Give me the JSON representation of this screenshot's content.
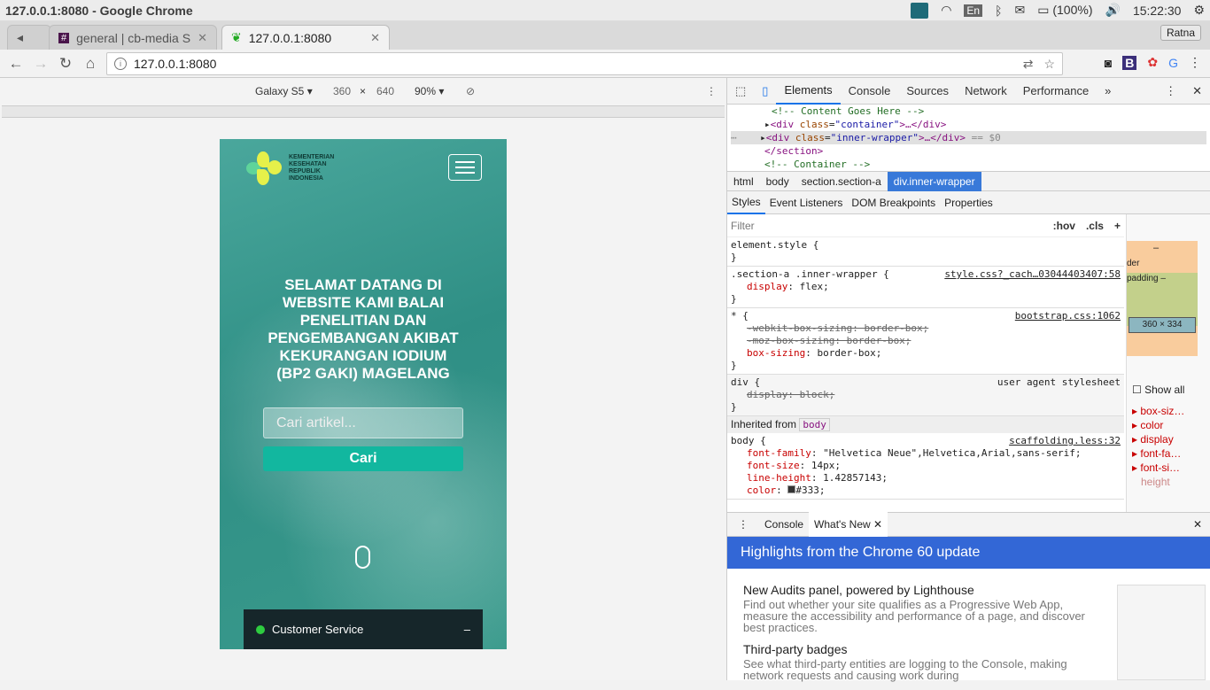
{
  "window": {
    "title": "127.0.0.1:8080 - Google Chrome"
  },
  "tray": {
    "lang": "En",
    "battery": "(100%)",
    "time": "15:22:30"
  },
  "tabs": [
    {
      "label": "general | cb-media S"
    },
    {
      "label": "127.0.0.1:8080"
    }
  ],
  "profile": "Ratna",
  "omnibox": {
    "url": "127.0.0.1:8080"
  },
  "device_toolbar": {
    "device": "Galaxy S5",
    "width": "360",
    "times": "×",
    "height": "640",
    "zoom": "90%"
  },
  "site": {
    "logo_text": "KEMENTERIAN KESEHATAN REPUBLIK INDONESIA",
    "headline": "SELAMAT DATANG DI WEBSITE KAMI BALAI PENELITIAN DAN PENGEMBANGAN AKIBAT KEKURANGAN IODIUM (BP2 GAKI) MAGELANG",
    "search_placeholder": "Cari artikel...",
    "search_button": "Cari",
    "cs_label": "Customer Service",
    "cs_minimize": "–"
  },
  "devtools": {
    "tabs": [
      "Elements",
      "Console",
      "Sources",
      "Network",
      "Performance"
    ],
    "dom": {
      "l1": "<!-- Content Goes Here -->",
      "l2_tag": "div",
      "l2_attr": "class",
      "l2_val": "\"container\"",
      "l3_tag": "div",
      "l3_attr": "class",
      "l3_val": "\"inner-wrapper\"",
      "l3_suffix": "== $0",
      "l4": "</section>",
      "l5": "<!-- Container -->"
    },
    "breadcrumbs": [
      "html",
      "body",
      "section.section-a",
      "div.inner-wrapper"
    ],
    "subtabs": [
      "Styles",
      "Event Listeners",
      "DOM Breakpoints",
      "Properties"
    ],
    "filter": "Filter",
    "hov": ":hov",
    "cls": ".cls",
    "plus": "+",
    "rules": {
      "r0_sel": "element.style {",
      "r1_sel": ".section-a .inner-wrapper {",
      "r1_src": "style.css?_cach…03044403407:58",
      "r1_p1n": "display",
      "r1_p1v": "flex;",
      "r2_sel": "* {",
      "r2_src": "bootstrap.css:1062",
      "r2_p1": "-webkit-box-sizing: border-box;",
      "r2_p2": "-moz-box-sizing: border-box;",
      "r2_p3n": "box-sizing",
      "r2_p3v": "border-box;",
      "r3_sel": "div {",
      "r3_src": "user agent stylesheet",
      "r3_p1": "display: block;",
      "inherited": "Inherited from",
      "inherited_tag": "body",
      "r4_sel": "body {",
      "r4_src": "scaffolding.less:32",
      "r4_p1n": "font-family",
      "r4_p1v": "\"Helvetica Neue\",Helvetica,Arial,sans-serif;",
      "r4_p2n": "font-size",
      "r4_p2v": "14px;",
      "r4_p3n": "line-height",
      "r4_p3v": "1.42857143;",
      "r4_p4n": "color",
      "r4_p4v": "#333;",
      "close": "}"
    },
    "boxmodel": {
      "content": "360 × 334",
      "dash": "–",
      "border": "der",
      "padding": "padding –"
    },
    "computed": {
      "showall": "Show all",
      "props": [
        "box-siz…",
        "color",
        "display",
        "font-fa…",
        "font-si…",
        "height"
      ]
    },
    "drawer": {
      "tabs": [
        "Console",
        "What's New"
      ],
      "banner": "Highlights from the Chrome 60 update",
      "items": [
        {
          "title": "New Audits panel, powered by Lighthouse",
          "desc": "Find out whether your site qualifies as a Progressive Web App, measure the accessibility and performance of a page, and discover best practices."
        },
        {
          "title": "Third-party badges",
          "desc": "See what third-party entities are logging to the Console, making network requests and causing work during"
        }
      ]
    }
  },
  "colors": {
    "accent": "#12b79f",
    "devtools_blue": "#3367d6",
    "selected_crumb": "#3879d9"
  }
}
